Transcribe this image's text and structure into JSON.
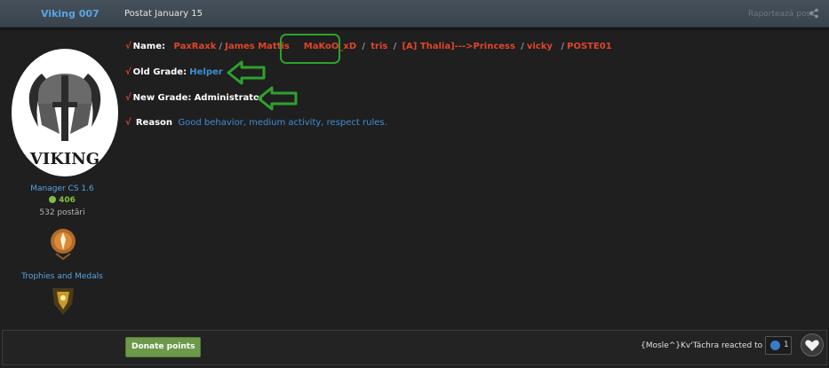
{
  "header": {
    "author": "Viking 007",
    "date": "Postat January 15",
    "report": "Raportează post"
  },
  "profile": {
    "avatar_text": "VIKING",
    "role": "Manager CS 1.6",
    "reputation": "406",
    "posts": "532 postări",
    "trophies_label": "Trophies and Medals"
  },
  "post": {
    "name_label": "Name:",
    "names": [
      "PaxRaxk",
      "James Mattis",
      "MaKoO_xD",
      "tris",
      "[A] Thalia]--->Princess",
      "vicky",
      "POSTE01"
    ],
    "old_grade_label": "Old Grade:",
    "old_grade": "Helper",
    "new_grade_label": "New Grade:",
    "new_grade": "Administrator",
    "reason_label": "Reason",
    "reason": "Good behavior, medium activity, respect rules."
  },
  "footer": {
    "donate": "Donate points",
    "reacted": "{Mosle^}Kv'Táchra reacted to this",
    "count": "1"
  },
  "colors": {
    "header_bg": "#3f4953",
    "accent_blue": "#58a6e6",
    "name_red": "#e0452a",
    "highlight_green": "#2fa02f",
    "donate_green": "#6c9a4a"
  }
}
